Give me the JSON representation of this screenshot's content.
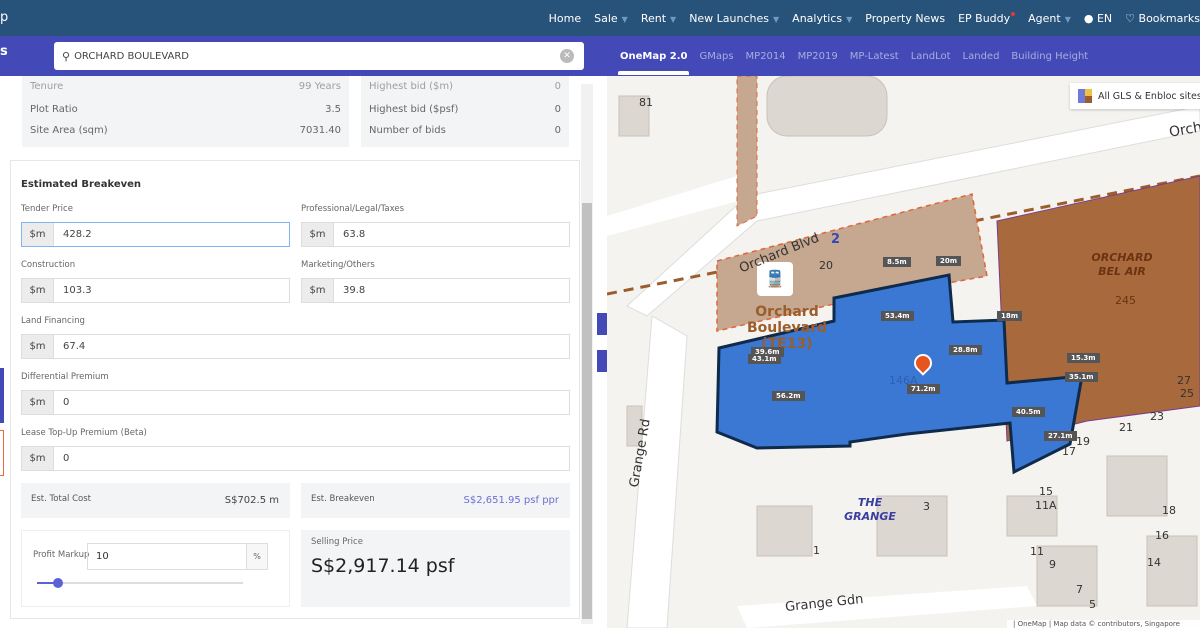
{
  "topnav": {
    "logo": "p",
    "items": [
      {
        "label": "Home",
        "caret": false
      },
      {
        "label": "Sale",
        "caret": true
      },
      {
        "label": "Rent",
        "caret": true
      },
      {
        "label": "New Launches",
        "caret": true
      },
      {
        "label": "Analytics",
        "caret": true
      },
      {
        "label": "Property News",
        "caret": false
      },
      {
        "label": "EP Buddy",
        "caret": false
      },
      {
        "label": "Agent",
        "caret": true
      }
    ],
    "lang": "EN",
    "bookmarks": "Bookmarks"
  },
  "subbar": {
    "left_label": "s",
    "search_value": "ORCHARD BOULEVARD",
    "map_tabs": [
      "OneMap 2.0",
      "GMaps",
      "MP2014",
      "MP2019",
      "MP-Latest",
      "LandLot",
      "Landed",
      "Building Height"
    ]
  },
  "info": {
    "left": [
      {
        "k": "Tenure",
        "v": "99 Years"
      },
      {
        "k": "Plot Ratio",
        "v": "3.5"
      },
      {
        "k": "Site Area (sqm)",
        "v": "7031.40"
      }
    ],
    "right": [
      {
        "k": "Highest bid ($m)",
        "v": "0"
      },
      {
        "k": "Highest bid ($psf)",
        "v": "0"
      },
      {
        "k": "Number of bids",
        "v": "0"
      }
    ]
  },
  "breakeven": {
    "title": "Estimated Breakeven",
    "unit": "$m",
    "fields": {
      "tender": {
        "label": "Tender Price",
        "value": "428.2"
      },
      "professional": {
        "label": "Professional/Legal/Taxes",
        "value": "63.8"
      },
      "construction": {
        "label": "Construction",
        "value": "103.3"
      },
      "marketing": {
        "label": "Marketing/Others",
        "value": "39.8"
      },
      "financing": {
        "label": "Land Financing",
        "value": "67.4"
      },
      "differential": {
        "label": "Differential Premium",
        "value": "0"
      },
      "topup": {
        "label": "Lease Top-Up Premium (Beta)",
        "value": "0"
      }
    },
    "total_cost_label": "Est. Total Cost",
    "total_cost": "S$702.5 m",
    "breakeven_label": "Est. Breakeven",
    "breakeven_value": "S$2,651.95 psf ppr",
    "markup_label": "Profit Markup",
    "markup_value": "10",
    "markup_unit": "%",
    "markup_slider_percent": 10,
    "selling_label": "Selling Price",
    "selling_value": "S$2,917.14 psf"
  },
  "map": {
    "legend": "All GLS & Enbloc sites",
    "roads": [
      "Orchard Blvd",
      "Grange Rd",
      "Grange Gdn"
    ],
    "station": "Orchard Boulevard (TE13)",
    "site_id": "146A",
    "the_grange": "THE GRANGE",
    "orchard_bel_air": "ORCHARD BEL AIR",
    "orchard_bel_air_num": "245",
    "exit": "2",
    "measures": [
      "8.5m",
      "20m",
      "53.4m",
      "18m",
      "39.6m",
      "43.1m",
      "28.8m",
      "15.3m",
      "35.1m",
      "71.2m",
      "56.2m",
      "40.5m",
      "27.1m"
    ],
    "numbers": [
      "81",
      "20",
      "27",
      "25",
      "23",
      "21",
      "19",
      "17",
      "15",
      "11A",
      "18",
      "16",
      "14",
      "11",
      "9",
      "7",
      "5",
      "3",
      "1",
      "Orch"
    ],
    "attribution": "| OneMap | Map data © contributors, Singapore"
  },
  "colors": {
    "nav": "#27527a",
    "accent": "#4349b6",
    "site": "#3a78d4",
    "gls": "#b48a66",
    "enbloc": "#9c5d2c"
  }
}
